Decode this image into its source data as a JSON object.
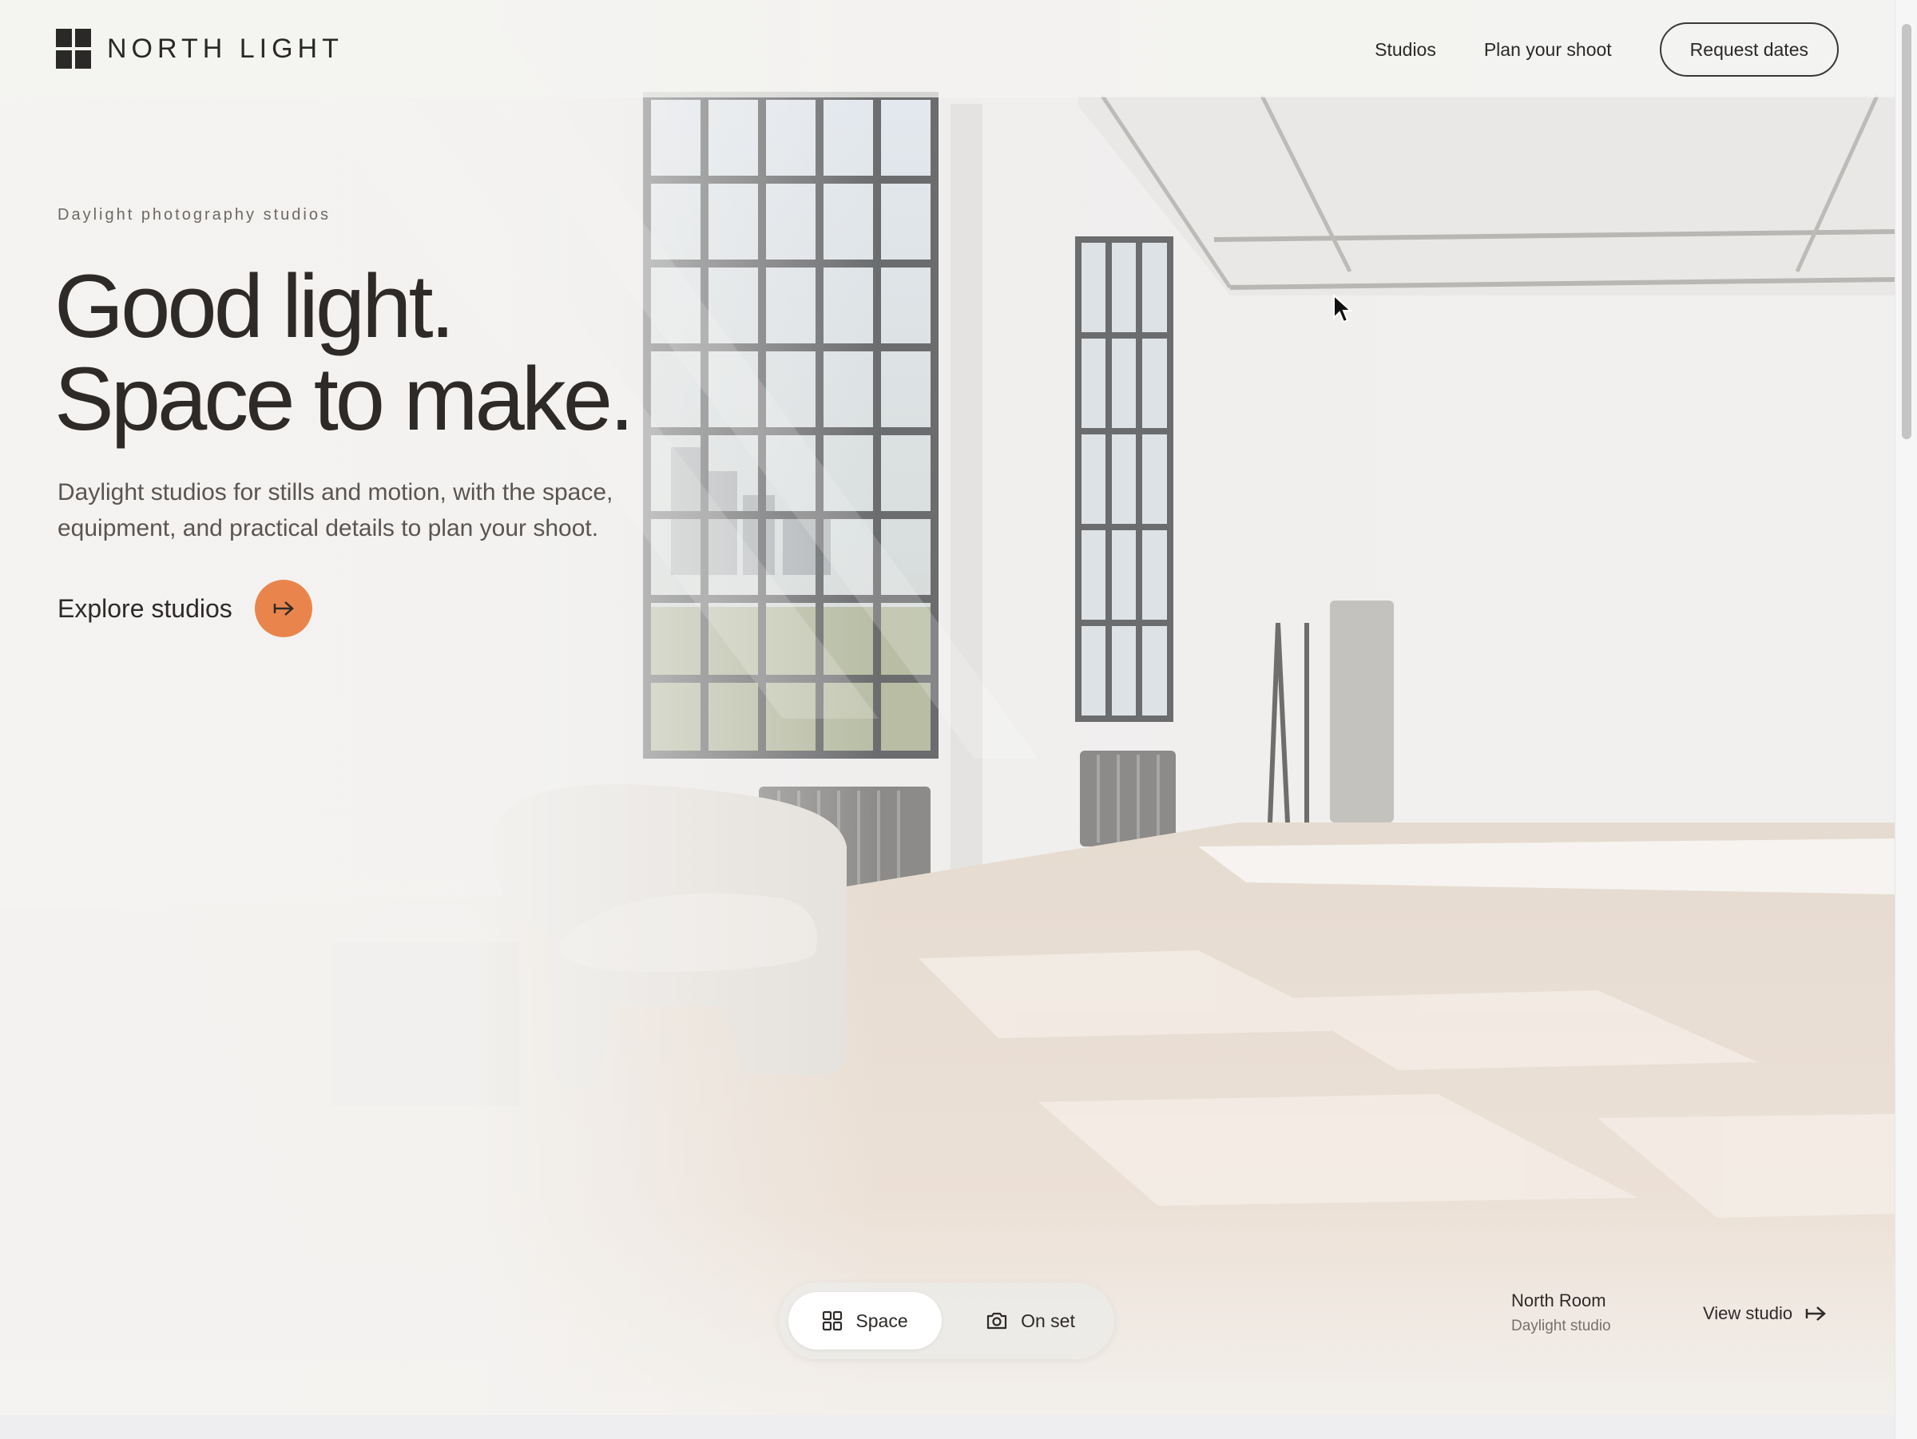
{
  "brand": {
    "name": "NORTH LIGHT",
    "logo_icon": "four-square-grid-icon"
  },
  "nav": {
    "studios": "Studios",
    "plan": "Plan your shoot",
    "request": "Request dates"
  },
  "hero": {
    "eyebrow": "Daylight photography studios",
    "headline_line1": "Good light.",
    "headline_line2": "Space to make.",
    "lede": "Daylight studios for stills and motion, with the space, equipment, and practical details to plan your shoot.",
    "cta_label": "Explore studios",
    "cta_icon": "arrow-right-icon"
  },
  "view_toggle": {
    "options": [
      {
        "label": "Space",
        "icon": "grid-icon",
        "active": true
      },
      {
        "label": "On set",
        "icon": "camera-icon",
        "active": false
      }
    ]
  },
  "studio": {
    "name": "North Room",
    "subtitle": "Daylight studio",
    "link": "View studio"
  },
  "colors": {
    "accent": "#e9854c",
    "text": "#2b2927",
    "background": "#f3f2f0"
  }
}
